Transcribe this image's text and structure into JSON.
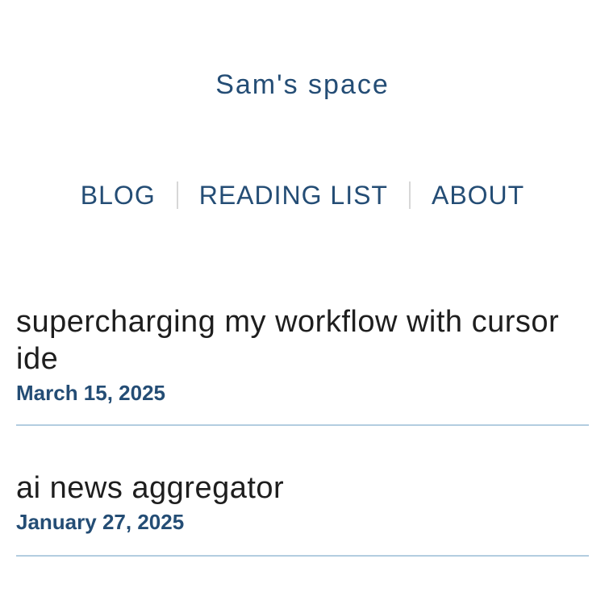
{
  "header": {
    "site_title": "Sam's space"
  },
  "nav": {
    "items": [
      {
        "label": "BLOG"
      },
      {
        "label": "READING LIST"
      },
      {
        "label": "ABOUT"
      }
    ]
  },
  "posts": [
    {
      "title": "supercharging my workflow with cursor ide",
      "date": "March 15, 2025"
    },
    {
      "title": "ai news aggregator",
      "date": "January 27, 2025"
    }
  ],
  "colors": {
    "accent": "#244d75",
    "text": "#1e1e1e",
    "divider": "#b3cde0",
    "nav_separator": "#d7d7d7",
    "background": "#ffffff"
  }
}
